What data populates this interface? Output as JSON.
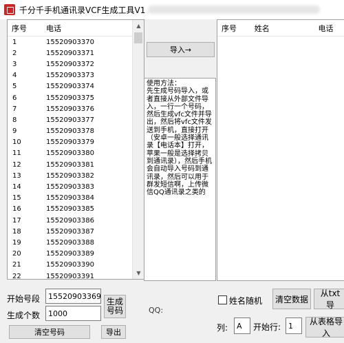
{
  "window": {
    "title": "千分千手机通讯录VCF生成工具V1"
  },
  "left_list": {
    "columns": [
      "序号",
      "电话"
    ],
    "rows": [
      [
        "1",
        "15520903370"
      ],
      [
        "2",
        "15520903371"
      ],
      [
        "3",
        "15520903372"
      ],
      [
        "4",
        "15520903373"
      ],
      [
        "5",
        "15520903374"
      ],
      [
        "6",
        "15520903375"
      ],
      [
        "7",
        "15520903376"
      ],
      [
        "8",
        "15520903377"
      ],
      [
        "9",
        "15520903378"
      ],
      [
        "10",
        "15520903379"
      ],
      [
        "11",
        "15520903380"
      ],
      [
        "12",
        "15520903381"
      ],
      [
        "13",
        "15520903382"
      ],
      [
        "14",
        "15520903383"
      ],
      [
        "15",
        "15520903384"
      ],
      [
        "16",
        "15520903385"
      ],
      [
        "17",
        "15520903386"
      ],
      [
        "18",
        "15520903387"
      ],
      [
        "19",
        "15520903388"
      ],
      [
        "20",
        "15520903389"
      ],
      [
        "21",
        "15520903390"
      ],
      [
        "22",
        "15520903391"
      ]
    ]
  },
  "middle": {
    "import_button": "导入→",
    "instructions": "使用方法：\n先生成号码导入，或者直接从外部文件导入，一行一个号码，然后生成vfc文件并导出，然后将vfc文件发送到手机，直接打开（安卓一般选择通讯录【电话本】打开，苹果一般是选择拷贝到通讯录），然后手机会自动导入号码到通讯录，然后可以用于群发短信啊，上传微信QQ通讯录之类的"
  },
  "right_table": {
    "columns": [
      "序号",
      "姓名",
      "电话"
    ]
  },
  "bottom_left": {
    "start_label": "开始号段",
    "start_value": "15520903369",
    "count_label": "生成个数",
    "count_value": "1000",
    "generate_button": "生成\n号码",
    "clear_button": "清空号码",
    "export_button": "导出"
  },
  "qq_label": "QQ:",
  "bottom_right": {
    "random_name_label": "姓名随机",
    "clear_data_button": "清空数据",
    "import_txt_button": "从txt导",
    "column_label": "列:",
    "column_value": "A",
    "start_row_label": "开始行:",
    "start_row_value": "1",
    "import_sheet_button": "从表格导入"
  }
}
